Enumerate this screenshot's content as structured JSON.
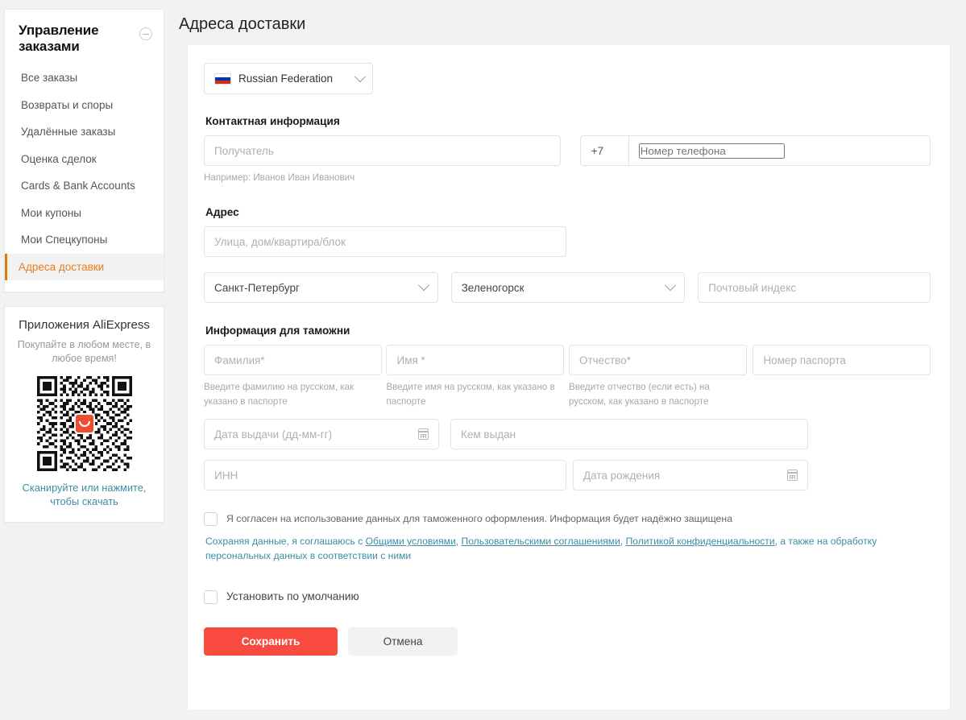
{
  "sidebar": {
    "nav_title": "Управление заказами",
    "collapse_icon": "minus-circle-icon",
    "items": [
      {
        "label": "Все заказы",
        "active": false
      },
      {
        "label": "Возвраты и споры",
        "active": false
      },
      {
        "label": "Удалённые заказы",
        "active": false
      },
      {
        "label": "Оценка сделок",
        "active": false
      },
      {
        "label": "Cards & Bank Accounts",
        "active": false
      },
      {
        "label": "Мои купоны",
        "active": false
      },
      {
        "label": "Мои Спецкупоны",
        "active": false
      },
      {
        "label": "Адреса доставки",
        "active": true
      }
    ],
    "promo": {
      "title": "Приложения AliExpress",
      "subtitle": "Покупайте в любом месте, в любое время!",
      "qr_icon": "qr-code",
      "qr_logo_icon": "aliexpress-logo-icon",
      "link": "Сканируйте или нажмите, чтобы скачать"
    }
  },
  "page": {
    "title": "Адреса доставки"
  },
  "form": {
    "country": {
      "flag_icon": "flag-russia-icon",
      "value": "Russian Federation",
      "chevron_icon": "chevron-down-icon"
    },
    "contact": {
      "section_title": "Контактная информация",
      "recipient_placeholder": "Получатель",
      "recipient_value": "",
      "recipient_hint": "Например: Иванов Иван Иванович",
      "phone_code": "+7",
      "phone_placeholder": "Номер телефона",
      "phone_value": ""
    },
    "address": {
      "section_title": "Адрес",
      "street_placeholder": "Улица, дом/квартира/блок",
      "street_value": "",
      "region_value": "Санкт-Петербург",
      "city_value": "Зеленогорск",
      "zip_placeholder": "Почтовый индекс",
      "zip_value": ""
    },
    "customs": {
      "section_title": "Информация для таможни",
      "lastname_placeholder": "Фамилия*",
      "lastname_value": "",
      "lastname_hint": "Введите фамилию на русском, как указано в паспорте",
      "firstname_placeholder": "Имя *",
      "firstname_value": "",
      "firstname_hint": "Введите имя на русском, как указано в паспорте",
      "patronymic_placeholder": "Отчество*",
      "patronymic_value": "",
      "patronymic_hint": "Введите отчество (если есть) на русском, как указано в паспорте",
      "passport_placeholder": "Номер паспорта",
      "passport_value": "",
      "issue_date_placeholder": "Дата выдачи (дд-мм-гг)",
      "issue_date_value": "",
      "issued_by_placeholder": "Кем выдан",
      "issued_by_value": "",
      "inn_placeholder": "ИНН",
      "inn_value": "",
      "birth_date_placeholder": "Дата рождения",
      "birth_date_value": "",
      "calendar_icon": "calendar-icon"
    },
    "consent": {
      "checkbox_label": "Я согласен на использование данных для таможенного оформления. Информация будет надёжно защищена",
      "legal_prefix": "Сохраняя данные, я соглашаюсь с ",
      "legal_link1": "Общими условиями",
      "legal_sep1": ", ",
      "legal_link2": "Пользовательскими соглашениями",
      "legal_sep2": ", ",
      "legal_link3": "Политикой конфиденциальности",
      "legal_suffix": ", а также на обработку персональных данных в соответствии с ними"
    },
    "default_address": {
      "checkbox_label": "Установить по умолчанию"
    },
    "buttons": {
      "save": "Сохранить",
      "cancel": "Отмена"
    }
  },
  "colors": {
    "accent_red": "#f94a40",
    "active_orange": "#e67e22",
    "link_teal": "#3c8ca3"
  }
}
